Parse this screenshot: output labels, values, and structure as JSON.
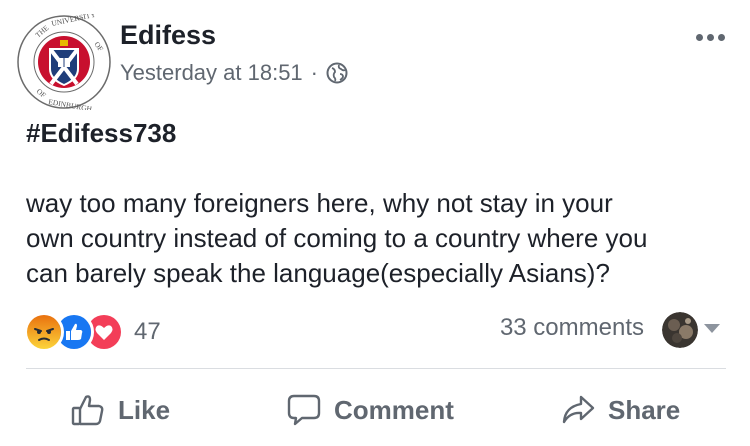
{
  "post": {
    "page_name": "Edifess",
    "timestamp": "Yesterday at 18:51",
    "separator": "·",
    "privacy_icon": "globe-icon",
    "avatar_icon": "university-of-edinburgh-seal",
    "seal_text": "THE UNIVERSITY OF EDINBURGH",
    "hashtag": "#Edifess738",
    "body_lines": [
      "way too many foreigners here, why not stay in your",
      "own country instead of coming to a country where you",
      "can barely speak the language(especially Asians)?"
    ]
  },
  "engagement": {
    "reaction_icons": [
      "angry-reaction-icon",
      "like-reaction-icon",
      "love-reaction-icon"
    ],
    "reaction_count": "47",
    "comments_count": "33 comments"
  },
  "actions": {
    "like": "Like",
    "comment": "Comment",
    "share": "Share"
  },
  "colors": {
    "text": "#1d2129",
    "secondary": "#606770",
    "like_blue": "#1877f2",
    "love_red": "#f33e58",
    "angry_top": "#e9710f",
    "angry_bottom": "#fcd43a",
    "seal_red": "#c8102e",
    "seal_blue": "#1f3d7a"
  }
}
